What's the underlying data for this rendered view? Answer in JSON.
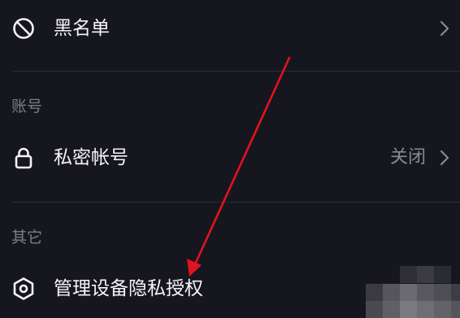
{
  "rows": {
    "blacklist": {
      "label": "黑名单"
    },
    "private_account": {
      "label": "私密帐号",
      "value": "关闭"
    },
    "device_privacy": {
      "label": "管理设备隐私授权"
    }
  },
  "sections": {
    "account": "账号",
    "other": "其它"
  },
  "icons": {
    "blacklist": "block-icon",
    "private_account": "lock-icon",
    "device_privacy": "hexagon-settings-icon",
    "chevron": "chevron-right-icon"
  },
  "colors": {
    "background": "#16161e",
    "text_primary": "#f4f4f6",
    "text_secondary": "#8a8b92",
    "section_header": "#7d7e86",
    "divider": "#2b2c35",
    "annotation_arrow": "#e0141e"
  }
}
